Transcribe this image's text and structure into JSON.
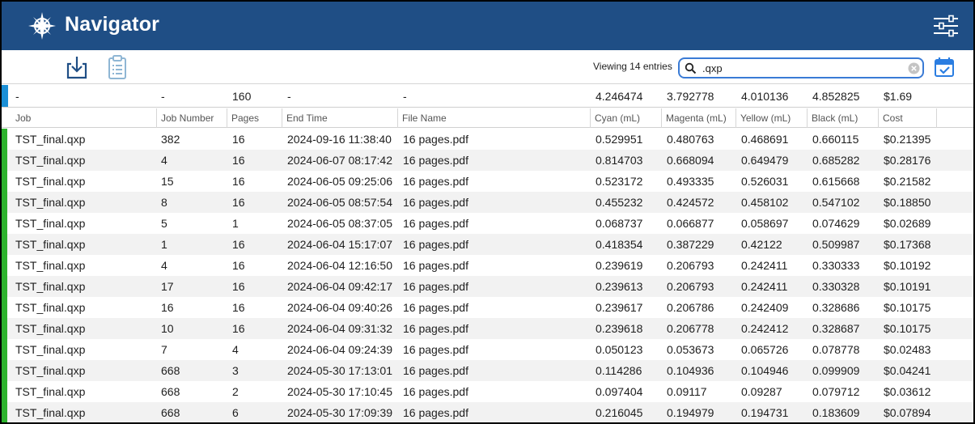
{
  "app": {
    "title": "Navigator"
  },
  "colors": {
    "header_bg": "#1f4e85",
    "accent_blue": "#1b8fd6",
    "row_status_green": "#2db32d"
  },
  "icons": {
    "logo": "compass-icon",
    "settings": "sliders-icon",
    "download": "download-icon",
    "clipboard": "clipboard-list-icon",
    "search": "search-icon",
    "clear": "clear-icon",
    "calendar": "calendar-check-icon"
  },
  "toolbar": {
    "viewing_label": "Viewing 14 entries",
    "search_value": ".qxp"
  },
  "summary": {
    "job": "-",
    "job_number": "-",
    "pages": "160",
    "end_time": "-",
    "file_name": "-",
    "cyan": "4.246474",
    "magenta": "3.792778",
    "yellow": "4.010136",
    "black": "4.852825",
    "cost": "$1.69"
  },
  "table": {
    "columns": [
      "Job",
      "Job Number",
      "Pages",
      "End Time",
      "File Name",
      "Cyan (mL)",
      "Magenta (mL)",
      "Yellow (mL)",
      "Black (mL)",
      "Cost"
    ],
    "rows": [
      [
        "TST_final.qxp",
        "382",
        "16",
        "2024-09-16 11:38:40",
        "16 pages.pdf",
        "0.529951",
        "0.480763",
        "0.468691",
        "0.660115",
        "$0.21395"
      ],
      [
        "TST_final.qxp",
        "4",
        "16",
        "2024-06-07 08:17:42",
        "16 pages.pdf",
        "0.814703",
        "0.668094",
        "0.649479",
        "0.685282",
        "$0.28176"
      ],
      [
        "TST_final.qxp",
        "15",
        "16",
        "2024-06-05 09:25:06",
        "16 pages.pdf",
        "0.523172",
        "0.493335",
        "0.526031",
        "0.615668",
        "$0.21582"
      ],
      [
        "TST_final.qxp",
        "8",
        "16",
        "2024-06-05 08:57:54",
        "16 pages.pdf",
        "0.455232",
        "0.424572",
        "0.458102",
        "0.547102",
        "$0.18850"
      ],
      [
        "TST_final.qxp",
        "5",
        "1",
        "2024-06-05 08:37:05",
        "16 pages.pdf",
        "0.068737",
        "0.066877",
        "0.058697",
        "0.074629",
        "$0.02689"
      ],
      [
        "TST_final.qxp",
        "1",
        "16",
        "2024-06-04 15:17:07",
        "16 pages.pdf",
        "0.418354",
        "0.387229",
        "0.42122",
        "0.509987",
        "$0.17368"
      ],
      [
        "TST_final.qxp",
        "4",
        "16",
        "2024-06-04 12:16:50",
        "16 pages.pdf",
        "0.239619",
        "0.206793",
        "0.242411",
        "0.330333",
        "$0.10192"
      ],
      [
        "TST_final.qxp",
        "17",
        "16",
        "2024-06-04 09:42:17",
        "16 pages.pdf",
        "0.239613",
        "0.206793",
        "0.242411",
        "0.330328",
        "$0.10191"
      ],
      [
        "TST_final.qxp",
        "16",
        "16",
        "2024-06-04 09:40:26",
        "16 pages.pdf",
        "0.239617",
        "0.206786",
        "0.242409",
        "0.328686",
        "$0.10175"
      ],
      [
        "TST_final.qxp",
        "10",
        "16",
        "2024-06-04 09:31:32",
        "16 pages.pdf",
        "0.239618",
        "0.206778",
        "0.242412",
        "0.328687",
        "$0.10175"
      ],
      [
        "TST_final.qxp",
        "7",
        "4",
        "2024-06-04 09:24:39",
        "16 pages.pdf",
        "0.050123",
        "0.053673",
        "0.065726",
        "0.078778",
        "$0.02483"
      ],
      [
        "TST_final.qxp",
        "668",
        "3",
        "2024-05-30 17:13:01",
        "16 pages.pdf",
        "0.114286",
        "0.104936",
        "0.104946",
        "0.099909",
        "$0.04241"
      ],
      [
        "TST_final.qxp",
        "668",
        "2",
        "2024-05-30 17:10:45",
        "16 pages.pdf",
        "0.097404",
        "0.09117",
        "0.09287",
        "0.079712",
        "$0.03612"
      ],
      [
        "TST_final.qxp",
        "668",
        "6",
        "2024-05-30 17:09:39",
        "16 pages.pdf",
        "0.216045",
        "0.194979",
        "0.194731",
        "0.183609",
        "$0.07894"
      ]
    ]
  }
}
